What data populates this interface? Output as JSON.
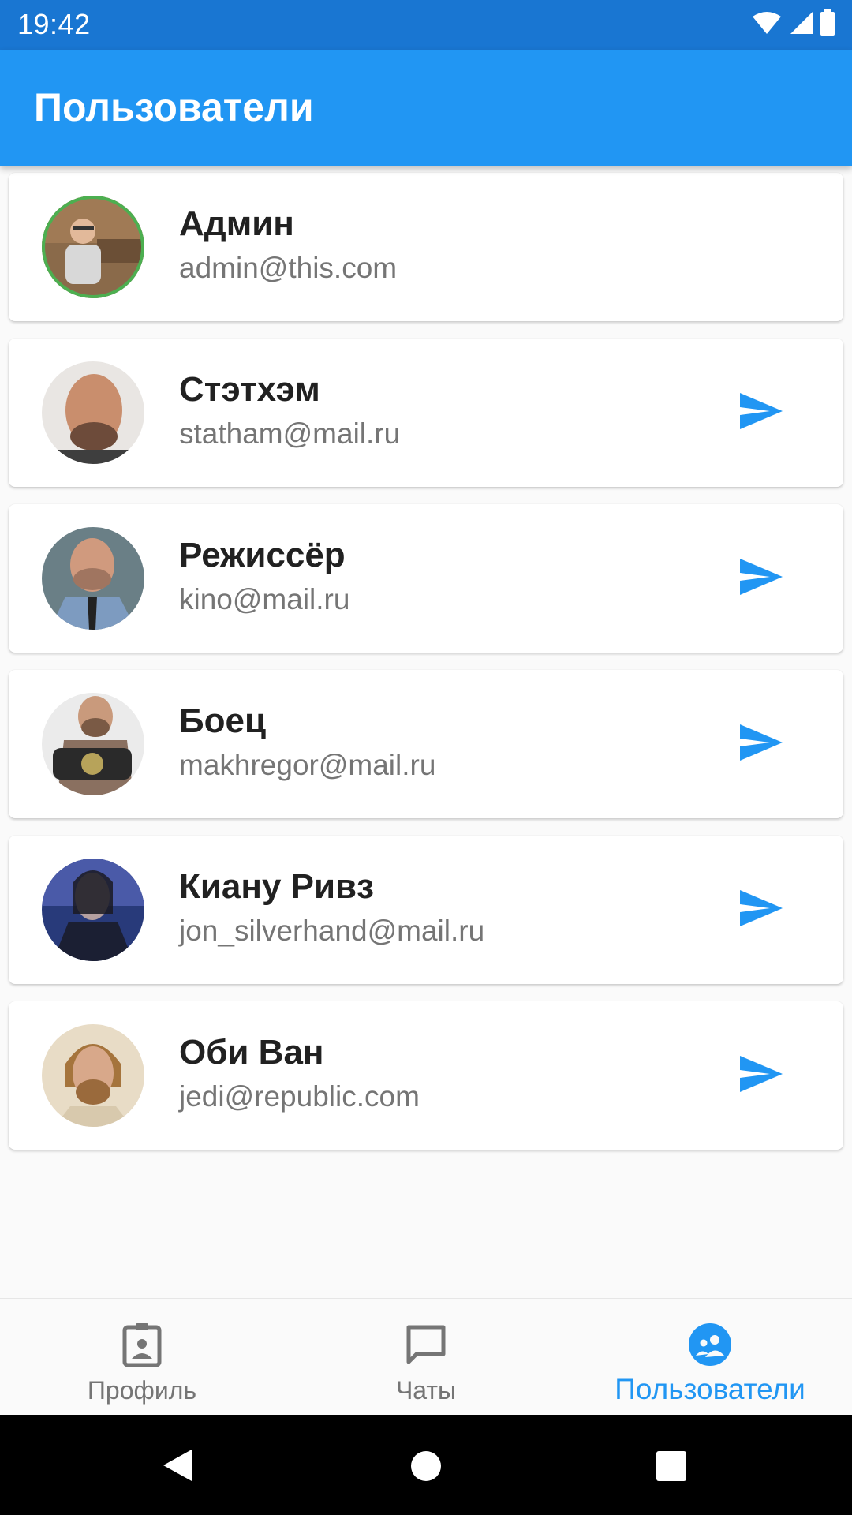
{
  "status_bar": {
    "time": "19:42"
  },
  "app_bar": {
    "title": "Пользователи"
  },
  "users": [
    {
      "name": "Админ",
      "email": "admin@this.com",
      "online": true,
      "can_message": false
    },
    {
      "name": "Стэтхэм",
      "email": "statham@mail.ru",
      "online": false,
      "can_message": true
    },
    {
      "name": "Режиссёр",
      "email": "kino@mail.ru",
      "online": false,
      "can_message": true
    },
    {
      "name": "Боец",
      "email": "makhregor@mail.ru",
      "online": false,
      "can_message": true
    },
    {
      "name": "Киану Ривз",
      "email": "jon_silverhand@mail.ru",
      "online": false,
      "can_message": true
    },
    {
      "name": "Оби Ван",
      "email": "jedi@republic.com",
      "online": false,
      "can_message": true
    }
  ],
  "bottom_nav": {
    "items": [
      {
        "label": "Профиль",
        "icon": "profile-badge-icon",
        "active": false
      },
      {
        "label": "Чаты",
        "icon": "chat-bubble-icon",
        "active": false
      },
      {
        "label": "Пользователи",
        "icon": "users-group-icon",
        "active": true
      }
    ]
  },
  "colors": {
    "status_bar": "#1976d2",
    "app_bar": "#2196f3",
    "accent": "#2196f3",
    "online_ring": "#4caf50",
    "name_text": "#212121",
    "email_text": "#757575",
    "inactive_nav": "#757575"
  }
}
